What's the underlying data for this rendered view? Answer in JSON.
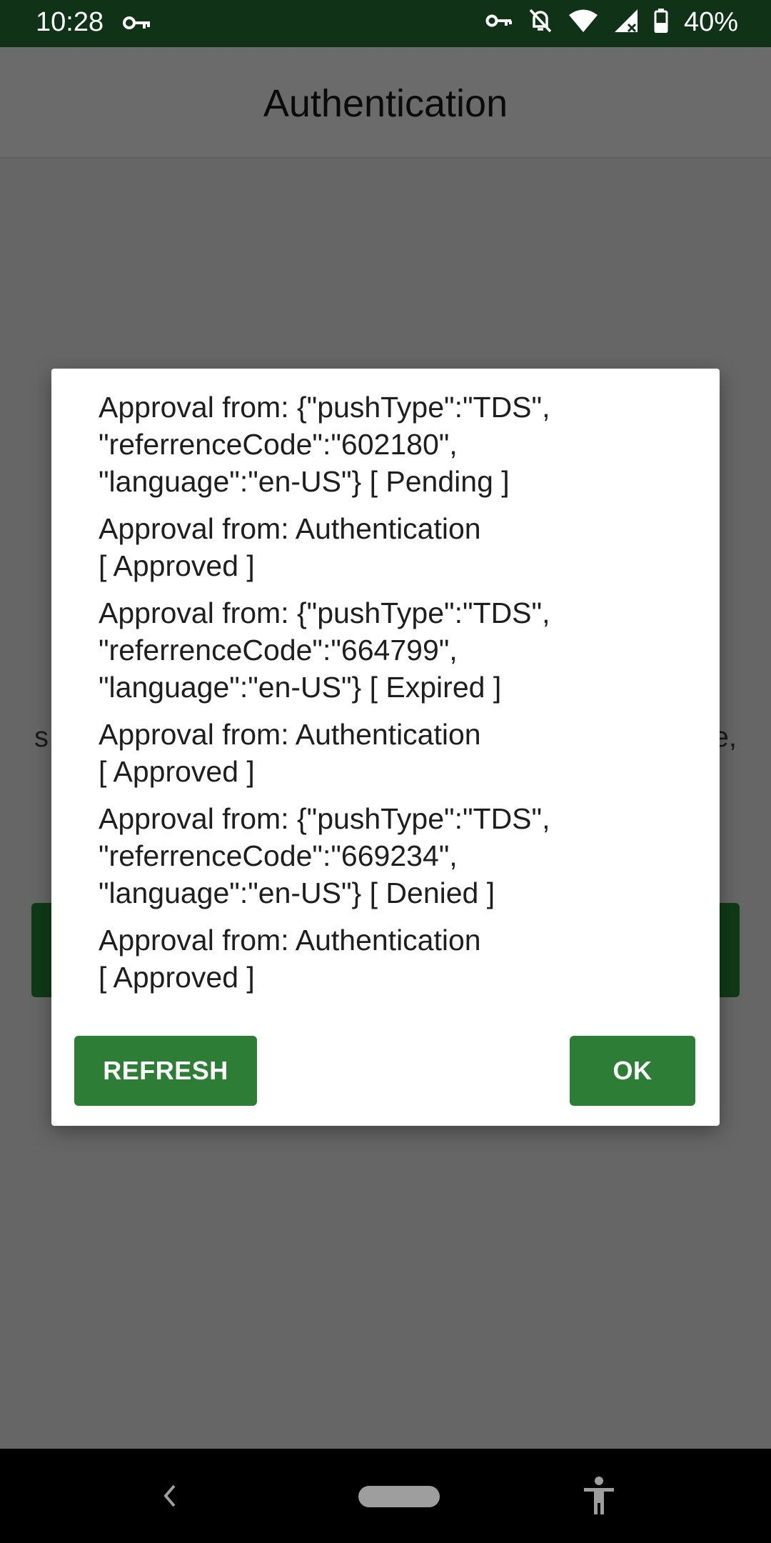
{
  "status_bar": {
    "time": "10:28",
    "battery": "40%",
    "icons": [
      "vpn-key-icon",
      "key-icon",
      "bell-off-icon",
      "wifi-icon",
      "signal-icon",
      "battery-icon"
    ]
  },
  "app_bar": {
    "title": "Authentication"
  },
  "background": {
    "left_fragment": "s",
    "right_fragment": "e,"
  },
  "dialog": {
    "items": [
      {
        "lines": [
          "Approval from: {\"pushType\":\"TDS\",",
          "\"referrenceCode\":\"602180\",",
          "\"language\":\"en-US\"} [ Pending ]"
        ]
      },
      {
        "lines": [
          "Approval from: Authentication",
          "[ Approved ]"
        ]
      },
      {
        "lines": [
          "Approval from: {\"pushType\":\"TDS\",",
          "\"referrenceCode\":\"664799\",",
          "\"language\":\"en-US\"} [ Expired ]"
        ]
      },
      {
        "lines": [
          "Approval from: Authentication",
          "[ Approved ]"
        ]
      },
      {
        "lines": [
          "Approval from: {\"pushType\":\"TDS\",",
          "\"referrenceCode\":\"669234\",",
          "\"language\":\"en-US\"} [ Denied ]"
        ]
      },
      {
        "lines": [
          "Approval from: Authentication",
          "[ Approved ]"
        ]
      }
    ],
    "refresh_label": "REFRESH",
    "ok_label": "OK"
  },
  "colors": {
    "status_bar": "#103318",
    "button": "#2e7d36",
    "scrim": "#666666"
  },
  "nav_bar": {
    "icons": [
      "back-icon",
      "home-pill-icon",
      "accessibility-icon"
    ]
  }
}
